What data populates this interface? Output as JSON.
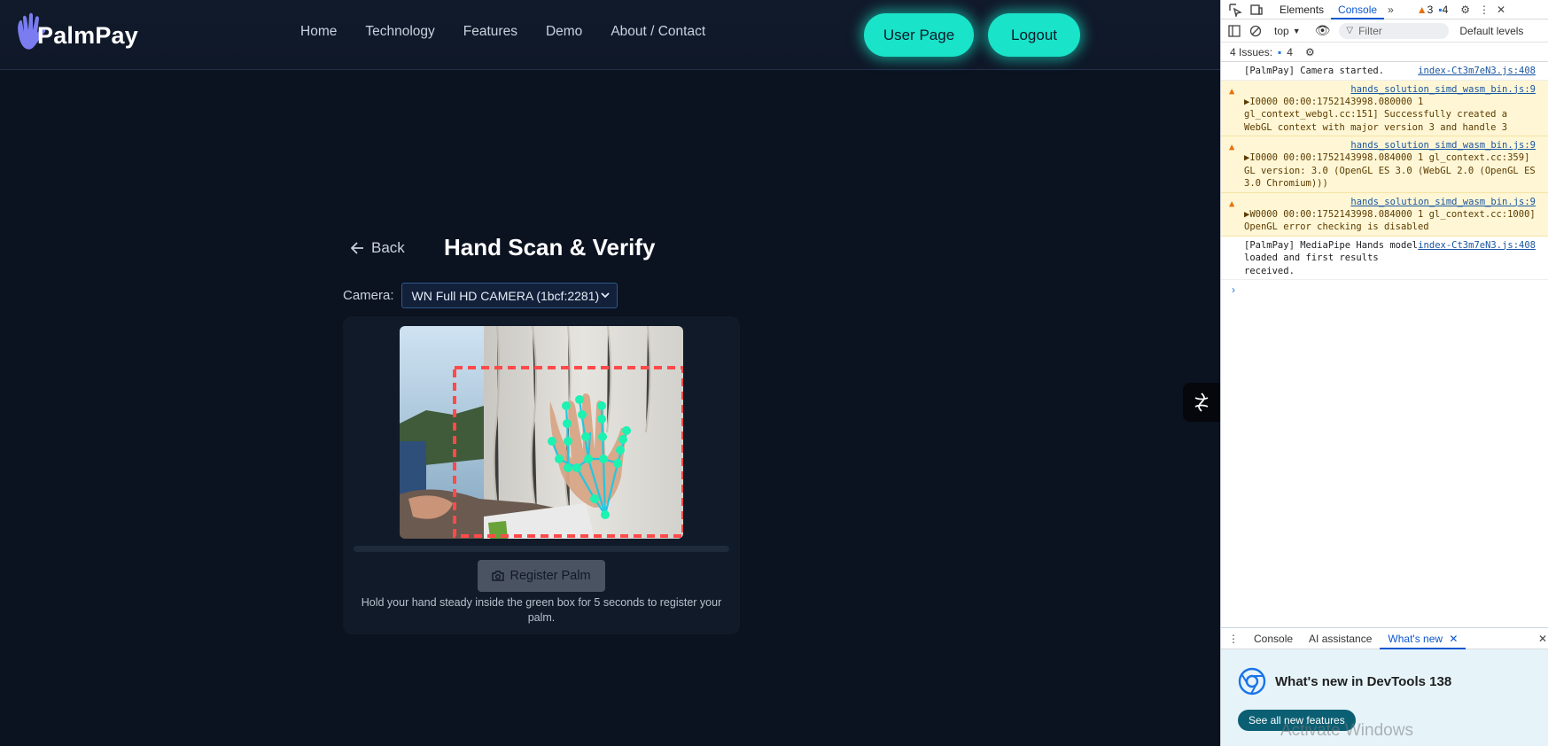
{
  "brand": {
    "name": "PalmPay"
  },
  "nav": {
    "links": [
      "Home",
      "Technology",
      "Features",
      "Demo",
      "About / Contact"
    ],
    "user_button": "User Page",
    "logout_button": "Logout"
  },
  "scan": {
    "back_label": "Back",
    "title": "Hand Scan & Verify",
    "camera_label": "Camera:",
    "camera_value": "WN Full HD CAMERA (1bcf:2281)",
    "register_button": "Register Palm",
    "hint": "Hold your hand steady inside the green box for 5 seconds to register your palm.",
    "progress": 0
  },
  "devtools": {
    "tabs": [
      "Elements",
      "Console"
    ],
    "active_tab": "Console",
    "warn_count": "3",
    "msg_count": "4",
    "context": "top",
    "filter_placeholder": "Filter",
    "levels": "Default levels",
    "issues_label": "4 Issues:",
    "issues_count": "4",
    "logs": [
      {
        "type": "info",
        "text": "[PalmPay] Camera started.",
        "src": "index-Ct3m7eN3.js:408"
      },
      {
        "type": "warn",
        "text": "▶I0000          00:00:1752143998.080000       1 gl_context_webgl.cc:151] Successfully created a WebGL context with major version 3 and handle 3",
        "src": "hands_solution_simd_wasm_bin.js:9"
      },
      {
        "type": "warn",
        "text": "▶I0000          00:00:1752143998.084000       1 gl_context.cc:359] GL version: 3.0 (OpenGL ES 3.0 (WebGL 2.0 (OpenGL ES 3.0 Chromium)))",
        "src": "hands_solution_simd_wasm_bin.js:9"
      },
      {
        "type": "warn",
        "text": "▶W0000          00:00:1752143998.084000       1 gl_context.cc:1000] OpenGL error checking is disabled",
        "src": "hands_solution_simd_wasm_bin.js:9"
      },
      {
        "type": "info",
        "text": "[PalmPay] MediaPipe Hands model loaded and first results received.",
        "src": "index-Ct3m7eN3.js:408"
      }
    ],
    "drawer_tabs": [
      "Console",
      "AI assistance",
      "What's new"
    ],
    "whats_new_title": "What's new in DevTools 138",
    "whats_new_button": "See all new features"
  },
  "watermark": "Activate Windows",
  "colors": {
    "accent": "#19e3c9",
    "bg": "#0b1220",
    "card": "#111a28"
  }
}
